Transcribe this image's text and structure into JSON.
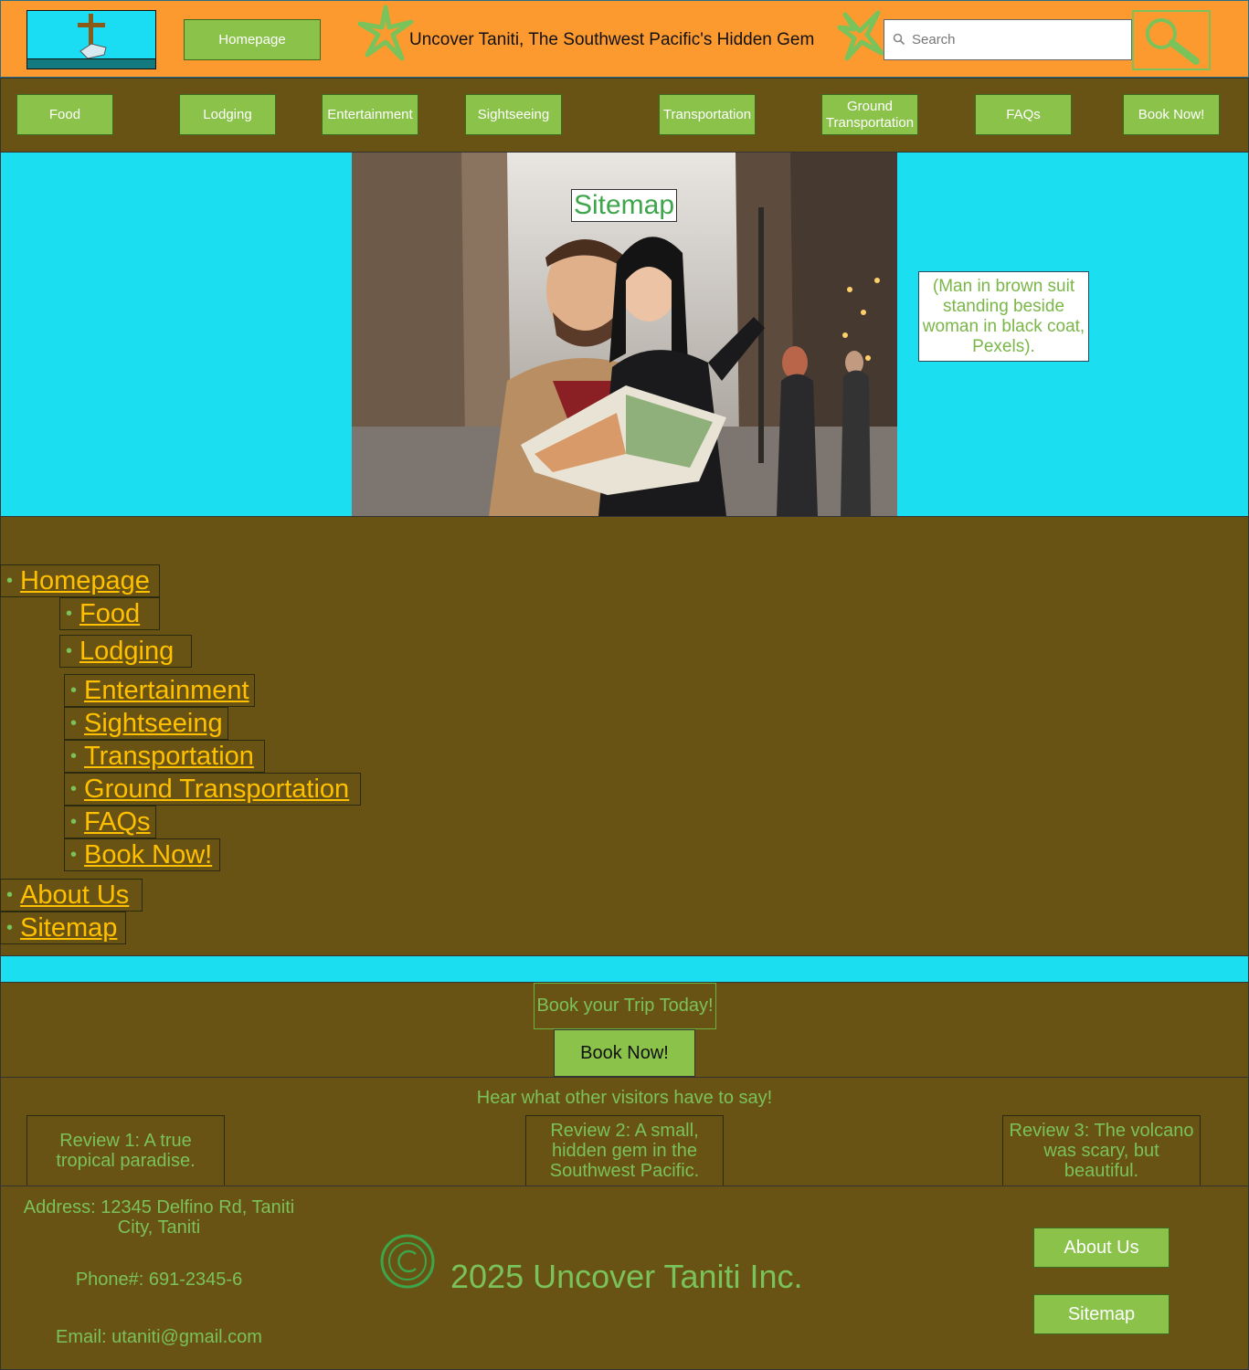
{
  "header": {
    "home_label": "Homepage",
    "title": "Uncover Taniti, The Southwest Pacific's Hidden Gem",
    "search_placeholder": "Search"
  },
  "nav": {
    "items": [
      "Food",
      "Lodging",
      "Entertainment",
      "Sightseeing",
      "Transportation",
      "Ground Transportation",
      "FAQs",
      "Book Now!"
    ]
  },
  "hero": {
    "heading": "Sitemap",
    "caption": "(Man in brown suit standing beside woman in black coat, Pexels)."
  },
  "sitemap": {
    "homepage": "Homepage",
    "children": [
      "Food",
      "Lodging",
      "Entertainment",
      "Sightseeing",
      "Transportation",
      "Ground Transportation",
      "FAQs",
      "Book Now!"
    ],
    "about": "About Us",
    "sitemap": "Sitemap"
  },
  "book": {
    "label": "Book your Trip Today!",
    "button": "Book Now!"
  },
  "reviews": {
    "heading": "Hear what other visitors have to say!",
    "items": [
      "Review 1: A true tropical paradise.",
      "Review 2: A small, hidden gem in the Southwest Pacific.",
      "Review 3: The volcano was scary, but beautiful."
    ]
  },
  "footer": {
    "address": "Address: 12345 Delfino Rd, Taniti City, Taniti",
    "phone": "Phone#: 691-2345-6",
    "email": "Email: utaniti@gmail.com",
    "copyright": "2025 Uncover Taniti Inc.",
    "about_button": "About Us",
    "sitemap_button": "Sitemap"
  },
  "colors": {
    "header_bg": "#fd9a2f",
    "brown_bg": "#695314",
    "cyan_bg": "#1bdef1",
    "button_green": "#8bc34a",
    "link_gold": "#ffc000"
  },
  "icons": [
    "logo-icon",
    "starfish-icon",
    "search-icon",
    "copyright-icon"
  ]
}
